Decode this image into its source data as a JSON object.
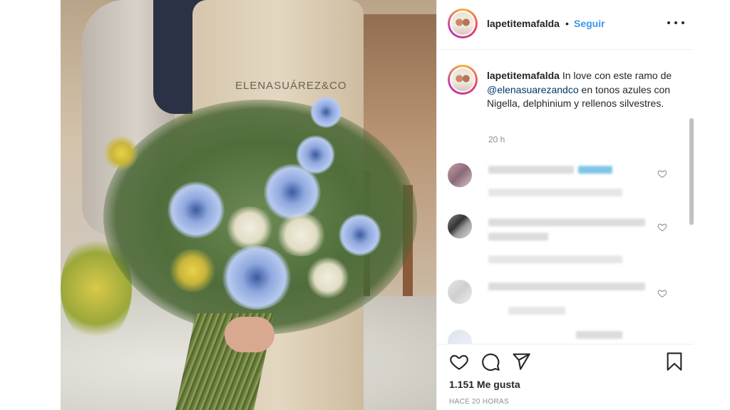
{
  "photo": {
    "alt_brand_text": "ELENASUÁREZ&CO"
  },
  "header": {
    "username": "lapetitemafalda",
    "separator": "•",
    "follow_label": "Seguir"
  },
  "caption": {
    "username": "lapetitemafalda",
    "text_before": "In love con este ramo de ",
    "mention": "@elenasuarezandco",
    "text_after": " en tonos azules con Nigella, delphinium y rellenos silvestres.",
    "time": "20 h"
  },
  "actions": {
    "likes": "1.151 Me gusta",
    "posted_ago": "HACE 20 HORAS"
  },
  "colors": {
    "link": "#3897f0",
    "mention": "#00376b",
    "muted": "#8e8e8e",
    "text": "#262626"
  },
  "icons": [
    "more-icon",
    "heart-icon",
    "comment-icon",
    "share-icon",
    "bookmark-icon"
  ]
}
